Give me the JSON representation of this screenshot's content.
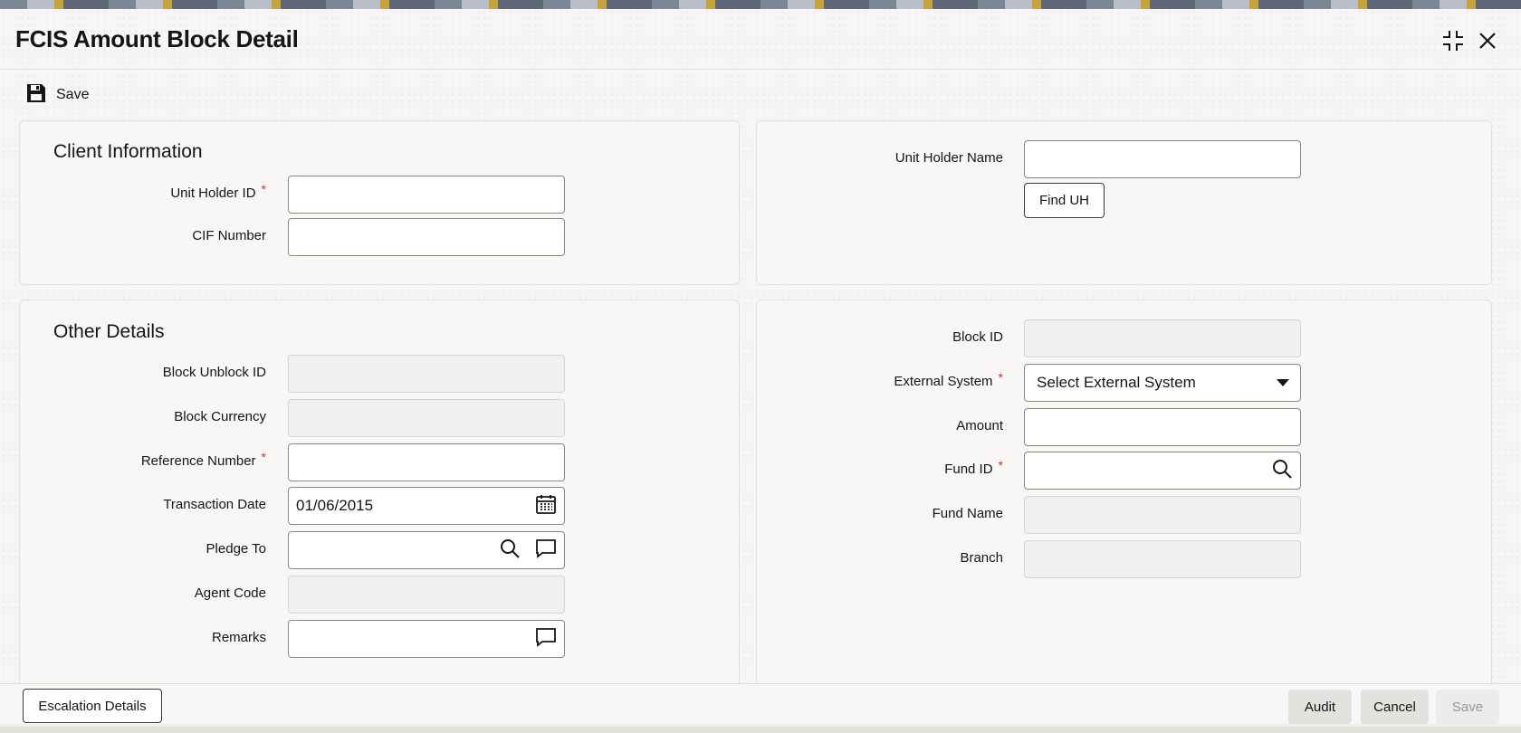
{
  "window": {
    "title": "FCIS Amount Block Detail"
  },
  "toolbar": {
    "save_label": "Save"
  },
  "client_info": {
    "section_title": "Client Information",
    "unit_holder_id_label": "Unit Holder ID",
    "unit_holder_id_value": "",
    "cif_number_label": "CIF Number",
    "cif_number_value": "",
    "unit_holder_name_label": "Unit Holder Name",
    "unit_holder_name_value": "",
    "find_uh_label": "Find UH"
  },
  "other_details": {
    "section_title": "Other Details",
    "block_unblock_id_label": "Block Unblock ID",
    "block_currency_label": "Block Currency",
    "reference_number_label": "Reference Number",
    "transaction_date_label": "Transaction Date",
    "transaction_date_value": "01/06/2015",
    "pledge_to_label": "Pledge To",
    "agent_code_label": "Agent Code",
    "remarks_label": "Remarks",
    "block_id_label": "Block ID",
    "external_system_label": "External System",
    "external_system_value": "Select External System",
    "amount_label": "Amount",
    "fund_id_label": "Fund ID",
    "fund_name_label": "Fund Name",
    "branch_label": "Branch"
  },
  "required_mark": "*",
  "footer": {
    "escalation_label": "Escalation Details",
    "audit_label": "Audit",
    "cancel_label": "Cancel",
    "save_label": "Save"
  },
  "colors": {
    "required": "#c0392b",
    "disabled_text": "#9b9894"
  }
}
